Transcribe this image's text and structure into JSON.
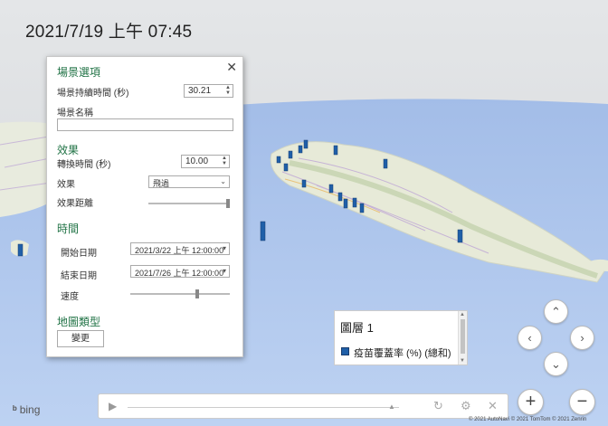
{
  "timestamp": "2021/7/19 上午 07:45",
  "scene_options": {
    "title": "場景選項",
    "duration_label": "場景持續時間 (秒)",
    "duration_value": "30.21",
    "name_label": "場景名稱",
    "name_value": "",
    "effects": {
      "title": "效果",
      "transition_label": "轉換時間 (秒)",
      "transition_value": "10.00",
      "effect_label": "效果",
      "effect_value": "飛過",
      "distance_label": "效果距離",
      "distance_level": 1.0
    },
    "time": {
      "title": "時間",
      "start_label": "開始日期",
      "start_value": "2021/3/22 上午 12:00:00",
      "end_label": "結束日期",
      "end_value": "2021/7/26 上午 12:00:00",
      "speed_label": "速度",
      "speed_level": 0.68
    },
    "map_type": {
      "title": "地圖類型",
      "change_label": "變更"
    }
  },
  "legend": {
    "title": "圖層 1",
    "entry": "疫苗覆蓋率 (%) (總和)",
    "color": "#1f5fa8"
  },
  "colors": {
    "accent": "#217346",
    "bar": "#1f5fa8",
    "sea": "#b4cbee",
    "land": "#e9ecdc"
  },
  "playbar": {
    "play_icon": "play-icon",
    "refresh_icon": "refresh-icon",
    "settings_icon": "gear-icon",
    "close_icon": "close-icon"
  },
  "branding": {
    "bing": "bing",
    "copyright": "© 2021 AutoNavi  © 2021 TomTom  © 2021 Zenrin"
  }
}
